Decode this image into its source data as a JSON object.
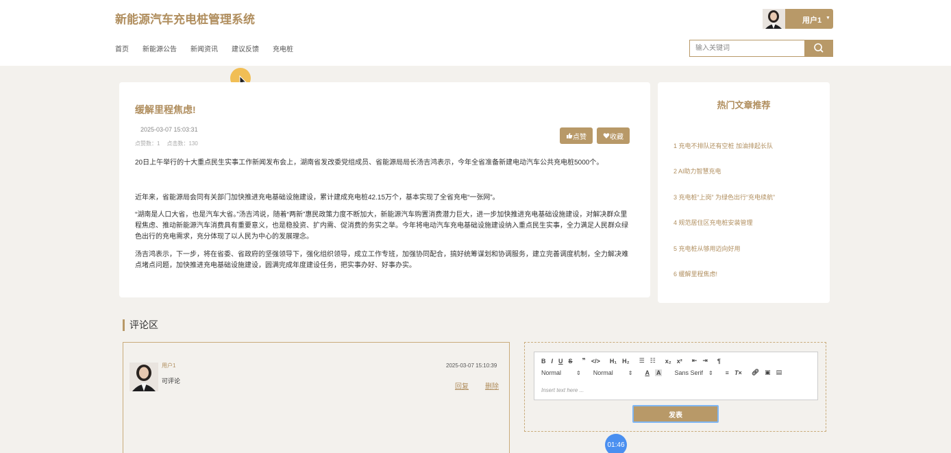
{
  "header": {
    "site_title": "新能源汽车充电桩管理系统",
    "nav": [
      "首页",
      "新能源公告",
      "新闻资讯",
      "建议反馈",
      "充电桩"
    ],
    "user_name": "用户1",
    "search_placeholder": "输入关键词"
  },
  "article": {
    "title": "缓解里程焦虑!",
    "date": "2025-03-07 15:03:31",
    "likes_label": "点赞数：1",
    "clicks_label": "点击数：130",
    "like_button": "点赞",
    "fav_button": "收藏",
    "paragraphs": [
      "20日上午举行的十大重点民生实事工作新闻发布会上，湖南省发改委党组成员、省能源局局长汤吉鸿表示，今年全省准备新建电动汽车公共充电桩5000个。",
      "近年来，省能源局会同有关部门加快推进充电基础设施建设，累计建成充电桩42.15万个，基本实现了全省充电“一张网”。",
      "“湖南是人口大省，也是汽车大省。”汤吉鸿说，随着“两新”惠民政策力度不断加大，新能源汽车购置消费潜力巨大，进一步加快推进充电基础设施建设，对解决群众里程焦虑、推动新能源汽车消费具有重要意义，也是稳投资、扩内需、促消费的务实之举。今年将电动汽车充电基础设施建设纳入重点民生实事，全力满足人民群众绿色出行的充电需求，充分体现了以人民为中心的发展理念。",
      "汤吉鸿表示，下一步，将在省委、省政府的坚强领导下，强化组织领导，成立工作专班，加强协同配合，搞好统筹谋划和协调服务，建立完善调度机制，全力解决难点堵点问题，加快推进充电基础设施建设，圆满完成年度建设任务，把实事办好、好事办实。"
    ]
  },
  "hot": {
    "title": "热门文章推荐",
    "items": [
      "1  充电不排队还有空桩 加油排起长队",
      "2  AI助力智慧充电",
      "3  充电桩“上岗” 为绿色出行“充电续航”",
      "4  规范居住区充电桩安装管理",
      "5  充电桩从够用迈向好用",
      "6  缓解里程焦虑!"
    ]
  },
  "comments": {
    "section_title": "评论区",
    "items": [
      {
        "user": "用户1",
        "text": "可评论",
        "time": "2025-03-07 15:10:39",
        "reply": "回复",
        "delete": "删除"
      }
    ]
  },
  "editor": {
    "format_select": "Normal",
    "size_select": "Normal",
    "font_select": "Sans Serif",
    "placeholder": "Insert text here ...",
    "send_button": "发表"
  },
  "timer": "01:46",
  "colors": {
    "accent": "#b89968",
    "accent_text": "#b08e5e",
    "page_bg": "#f3f1ed"
  }
}
